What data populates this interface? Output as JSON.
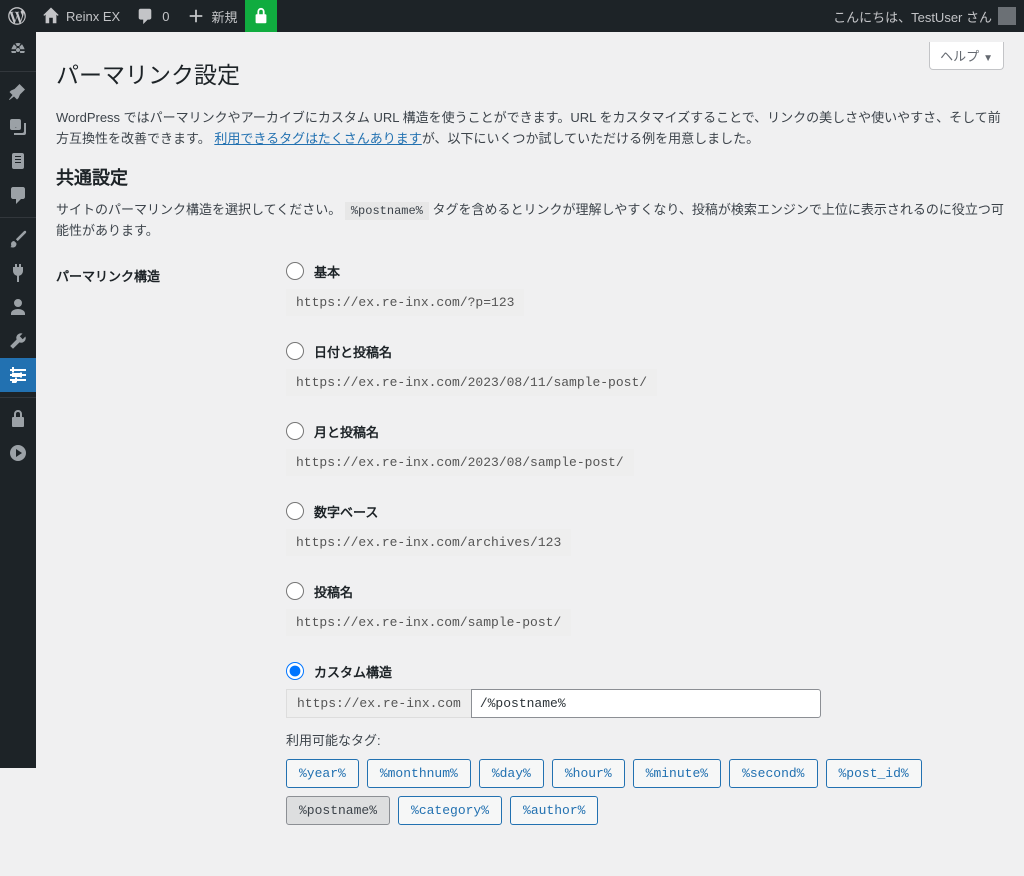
{
  "adminbar": {
    "site_name": "Reinx EX",
    "comments_count": "0",
    "new_label": "新規",
    "greeting": "こんにちは、TestUser さん"
  },
  "help_tab": "ヘルプ",
  "page": {
    "title": "パーマリンク設定",
    "intro_a": "WordPress ではパーマリンクやアーカイブにカスタム URL 構造を使うことができます。URL をカスタマイズすることで、リンクの美しさや使いやすさ、そして前方互換性を改善できます。",
    "intro_link": "利用できるタグはたくさんあります",
    "intro_b": "が、以下にいくつか試していただける例を用意しました。",
    "section_heading": "共通設定",
    "section_sub_a": "サイトのパーマリンク構造を選択してください。",
    "section_code": "%postname%",
    "section_sub_b": "タグを含めるとリンクが理解しやすくなり、投稿が検索エンジンで上位に表示されるのに役立つ可能性があります。"
  },
  "form": {
    "row_label": "パーマリンク構造",
    "options": [
      {
        "label": "基本",
        "sample": "https://ex.re-inx.com/?p=123"
      },
      {
        "label": "日付と投稿名",
        "sample": "https://ex.re-inx.com/2023/08/11/sample-post/"
      },
      {
        "label": "月と投稿名",
        "sample": "https://ex.re-inx.com/2023/08/sample-post/"
      },
      {
        "label": "数字ベース",
        "sample": "https://ex.re-inx.com/archives/123"
      },
      {
        "label": "投稿名",
        "sample": "https://ex.re-inx.com/sample-post/"
      }
    ],
    "custom_label": "カスタム構造",
    "custom_prefix": "https://ex.re-inx.com",
    "custom_value": "/%postname%",
    "tags_label": "利用可能なタグ:",
    "tags": [
      {
        "text": "%year%",
        "used": false
      },
      {
        "text": "%monthnum%",
        "used": false
      },
      {
        "text": "%day%",
        "used": false
      },
      {
        "text": "%hour%",
        "used": false
      },
      {
        "text": "%minute%",
        "used": false
      },
      {
        "text": "%second%",
        "used": false
      },
      {
        "text": "%post_id%",
        "used": false
      },
      {
        "text": "%postname%",
        "used": true
      },
      {
        "text": "%category%",
        "used": false
      },
      {
        "text": "%author%",
        "used": false
      }
    ]
  },
  "selected_option": 5
}
